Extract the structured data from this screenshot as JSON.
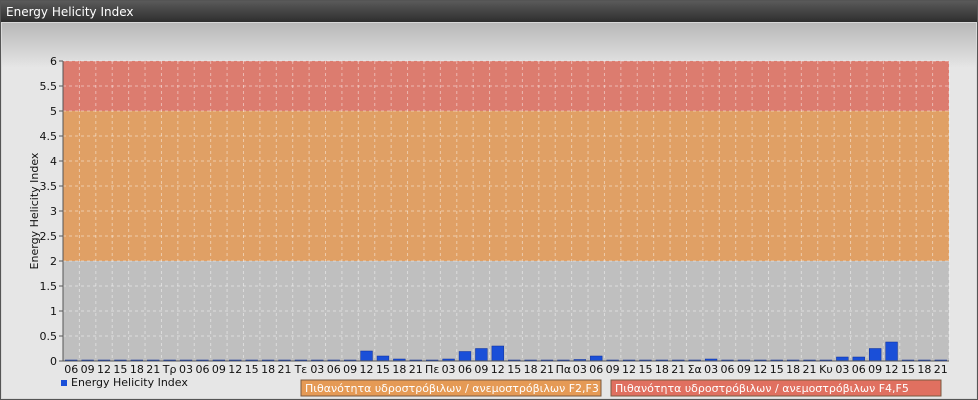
{
  "window": {
    "title": "Energy Helicity Index"
  },
  "chart_data": {
    "type": "bar",
    "ylabel": "Energy Helicity Index",
    "ylim": [
      0,
      6
    ],
    "yticks": [
      "0",
      "0.5",
      "1",
      "1.5",
      "2",
      "2.5",
      "3",
      "3.5",
      "4",
      "4.5",
      "5",
      "5.5",
      "6"
    ],
    "categories": [
      "06",
      "09",
      "12",
      "15",
      "18",
      "21",
      "Τρ",
      "03",
      "06",
      "09",
      "12",
      "15",
      "18",
      "21",
      "Τε",
      "03",
      "06",
      "09",
      "12",
      "15",
      "18",
      "21",
      "Πε",
      "03",
      "06",
      "09",
      "12",
      "15",
      "18",
      "21",
      "Πα",
      "03",
      "06",
      "09",
      "12",
      "15",
      "18",
      "21",
      "Σα",
      "03",
      "06",
      "09",
      "12",
      "15",
      "18",
      "21",
      "Κυ",
      "03",
      "06",
      "09",
      "12",
      "15",
      "18",
      "21"
    ],
    "series": [
      {
        "name": "Energy Helicity Index",
        "color": "#1a4fd8",
        "values": [
          0.02,
          0.02,
          0.02,
          0.02,
          0.02,
          0.02,
          0.02,
          0.02,
          0.02,
          0.02,
          0.02,
          0.02,
          0.02,
          0.02,
          0.02,
          0.02,
          0.02,
          0.02,
          0.2,
          0.1,
          0.04,
          0.02,
          0.02,
          0.04,
          0.19,
          0.25,
          0.3,
          0.02,
          0.02,
          0.02,
          0.02,
          0.03,
          0.1,
          0.02,
          0.02,
          0.02,
          0.02,
          0.02,
          0.02,
          0.04,
          0.02,
          0.02,
          0.02,
          0.02,
          0.02,
          0.02,
          0.02,
          0.08,
          0.08,
          0.25,
          0.38,
          0.02,
          0.02,
          0.02
        ]
      }
    ],
    "bands": [
      {
        "from": 2,
        "to": 5,
        "color": "#e59a55",
        "label": "Πιθανότητα υδροστρόβιλων / ανεμοστρόβιλων F2,F3"
      },
      {
        "from": 5,
        "to": 6,
        "color": "#e07060",
        "label": "Πιθανότητα υδροστρόβιλων / ανεμοστρόβιλων F4,F5"
      }
    ],
    "grid": true,
    "legend_position": "bottom-left"
  }
}
